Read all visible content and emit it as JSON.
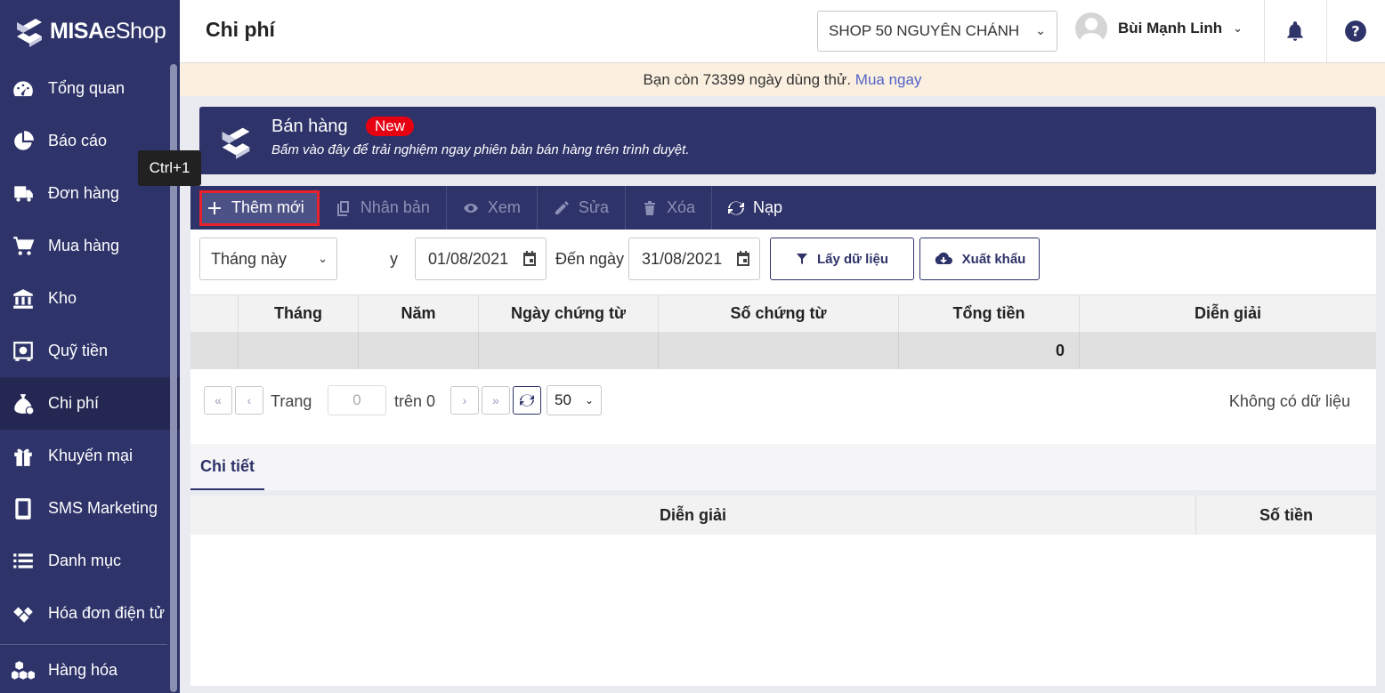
{
  "app": {
    "brand_bold": "MISA",
    "brand_light": "eShop"
  },
  "sidebar": {
    "items": [
      {
        "label": "Tổng quan",
        "icon": "dashboard-icon"
      },
      {
        "label": "Báo cáo",
        "icon": "pie-chart-icon"
      },
      {
        "label": "Đơn hàng",
        "icon": "delivery-truck-icon"
      },
      {
        "label": "Mua hàng",
        "icon": "cart-icon"
      },
      {
        "label": "Kho",
        "icon": "warehouse-icon"
      },
      {
        "label": "Quỹ tiền",
        "icon": "safe-icon"
      },
      {
        "label": "Chi phí",
        "icon": "money-bag-icon",
        "active": true
      },
      {
        "label": "Khuyến mại",
        "icon": "gift-icon"
      },
      {
        "label": "SMS Marketing",
        "icon": "phone-icon"
      },
      {
        "label": "Danh mục",
        "icon": "list-icon"
      },
      {
        "label": "Hóa đơn điện tử",
        "icon": "e-invoice-icon"
      },
      {
        "label": "Hàng hóa",
        "icon": "boxes-icon"
      }
    ]
  },
  "header": {
    "title": "Chi phí",
    "shop": "SHOP 50 NGUYÊN CHÁNH",
    "user": "Bùi Mạnh Linh"
  },
  "trial": {
    "text": "Bạn còn 73399 ngày dùng thử.",
    "link": "Mua ngay"
  },
  "promo": {
    "title": "Bán hàng",
    "badge": "New",
    "subtitle": "Bấm vào đây để trải nghiệm ngay phiên bản bán hàng trên trình duyệt."
  },
  "toolbar": {
    "add": "Thêm mới",
    "duplicate": "Nhân bản",
    "view": "Xem",
    "edit": "Sửa",
    "delete": "Xóa",
    "reload": "Nạp"
  },
  "filters": {
    "period": "Tháng này",
    "from_label_partial": "y",
    "from_date": "01/08/2021",
    "to_label": "Đến ngày",
    "to_date": "31/08/2021",
    "fetch": "Lấy dữ liệu",
    "export": "Xuất khẩu",
    "tooltip": "Ctrl+1"
  },
  "grid": {
    "columns": [
      "",
      "Tháng",
      "Năm",
      "Ngày chứng từ",
      "Số chứng từ",
      "Tổng tiền",
      "Diễn giải"
    ],
    "total_value": "0"
  },
  "pager": {
    "page_label": "Trang",
    "page_value": "0",
    "of_label": "trên 0",
    "page_size": "50",
    "empty": "Không có dữ liệu"
  },
  "detail": {
    "tab": "Chi tiết",
    "columns": [
      "Diễn giải",
      "Số tiền"
    ]
  },
  "colors": {
    "navy": "#2e3369",
    "trial_bg": "#fbf0df",
    "link": "#5263c8",
    "new_badge": "#e60012",
    "highlight_border": "#e8212a"
  }
}
